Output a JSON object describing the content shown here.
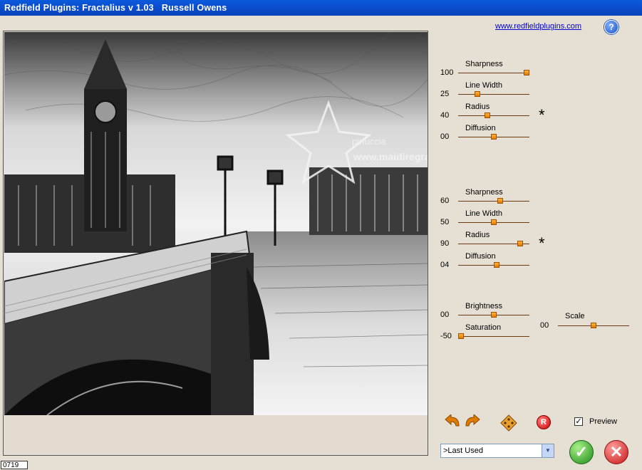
{
  "window": {
    "title": "Redfield Plugins: Fractalius v 1.03   Russell Owens"
  },
  "header": {
    "link": "www.redfieldplugins.com",
    "help_glyph": "?"
  },
  "watermark": {
    "line1": "pinuccia",
    "line2": "www.maidiregrafica.eu"
  },
  "group1": [
    {
      "label": "Sharpness",
      "value": "100",
      "fraction": 1.0
    },
    {
      "label": "Line Width",
      "value": "25",
      "fraction": 0.25
    },
    {
      "label": "Radius",
      "value": "40",
      "fraction": 0.4
    },
    {
      "label": "Diffusion",
      "value": "00",
      "fraction": 0.5
    }
  ],
  "group2": [
    {
      "label": "Sharpness",
      "value": "60",
      "fraction": 0.6
    },
    {
      "label": "Line Width",
      "value": "50",
      "fraction": 0.5
    },
    {
      "label": "Radius",
      "value": "90",
      "fraction": 0.9
    },
    {
      "label": "Diffusion",
      "value": "04",
      "fraction": 0.54
    }
  ],
  "group3": [
    {
      "label": "Brightness",
      "value": "00",
      "fraction": 0.5
    },
    {
      "label": "Saturation",
      "value": "-50",
      "fraction": 0.0
    }
  ],
  "scale": {
    "label": "Scale",
    "value": "00",
    "fraction": 0.5
  },
  "randomize_glyph": "*",
  "reset_glyph": "R",
  "preview": {
    "label": "Preview",
    "checked": true,
    "check_glyph": "✓"
  },
  "preset": {
    "selected": ">Last Used"
  },
  "ok_glyph": "✓",
  "cancel_glyph": "✕",
  "status": {
    "code": "0719"
  },
  "colors": {
    "title_bar": "#0b4fd0",
    "panel": "#e6dfd3",
    "thumb": "#f09000",
    "track": "#6b3a12"
  }
}
